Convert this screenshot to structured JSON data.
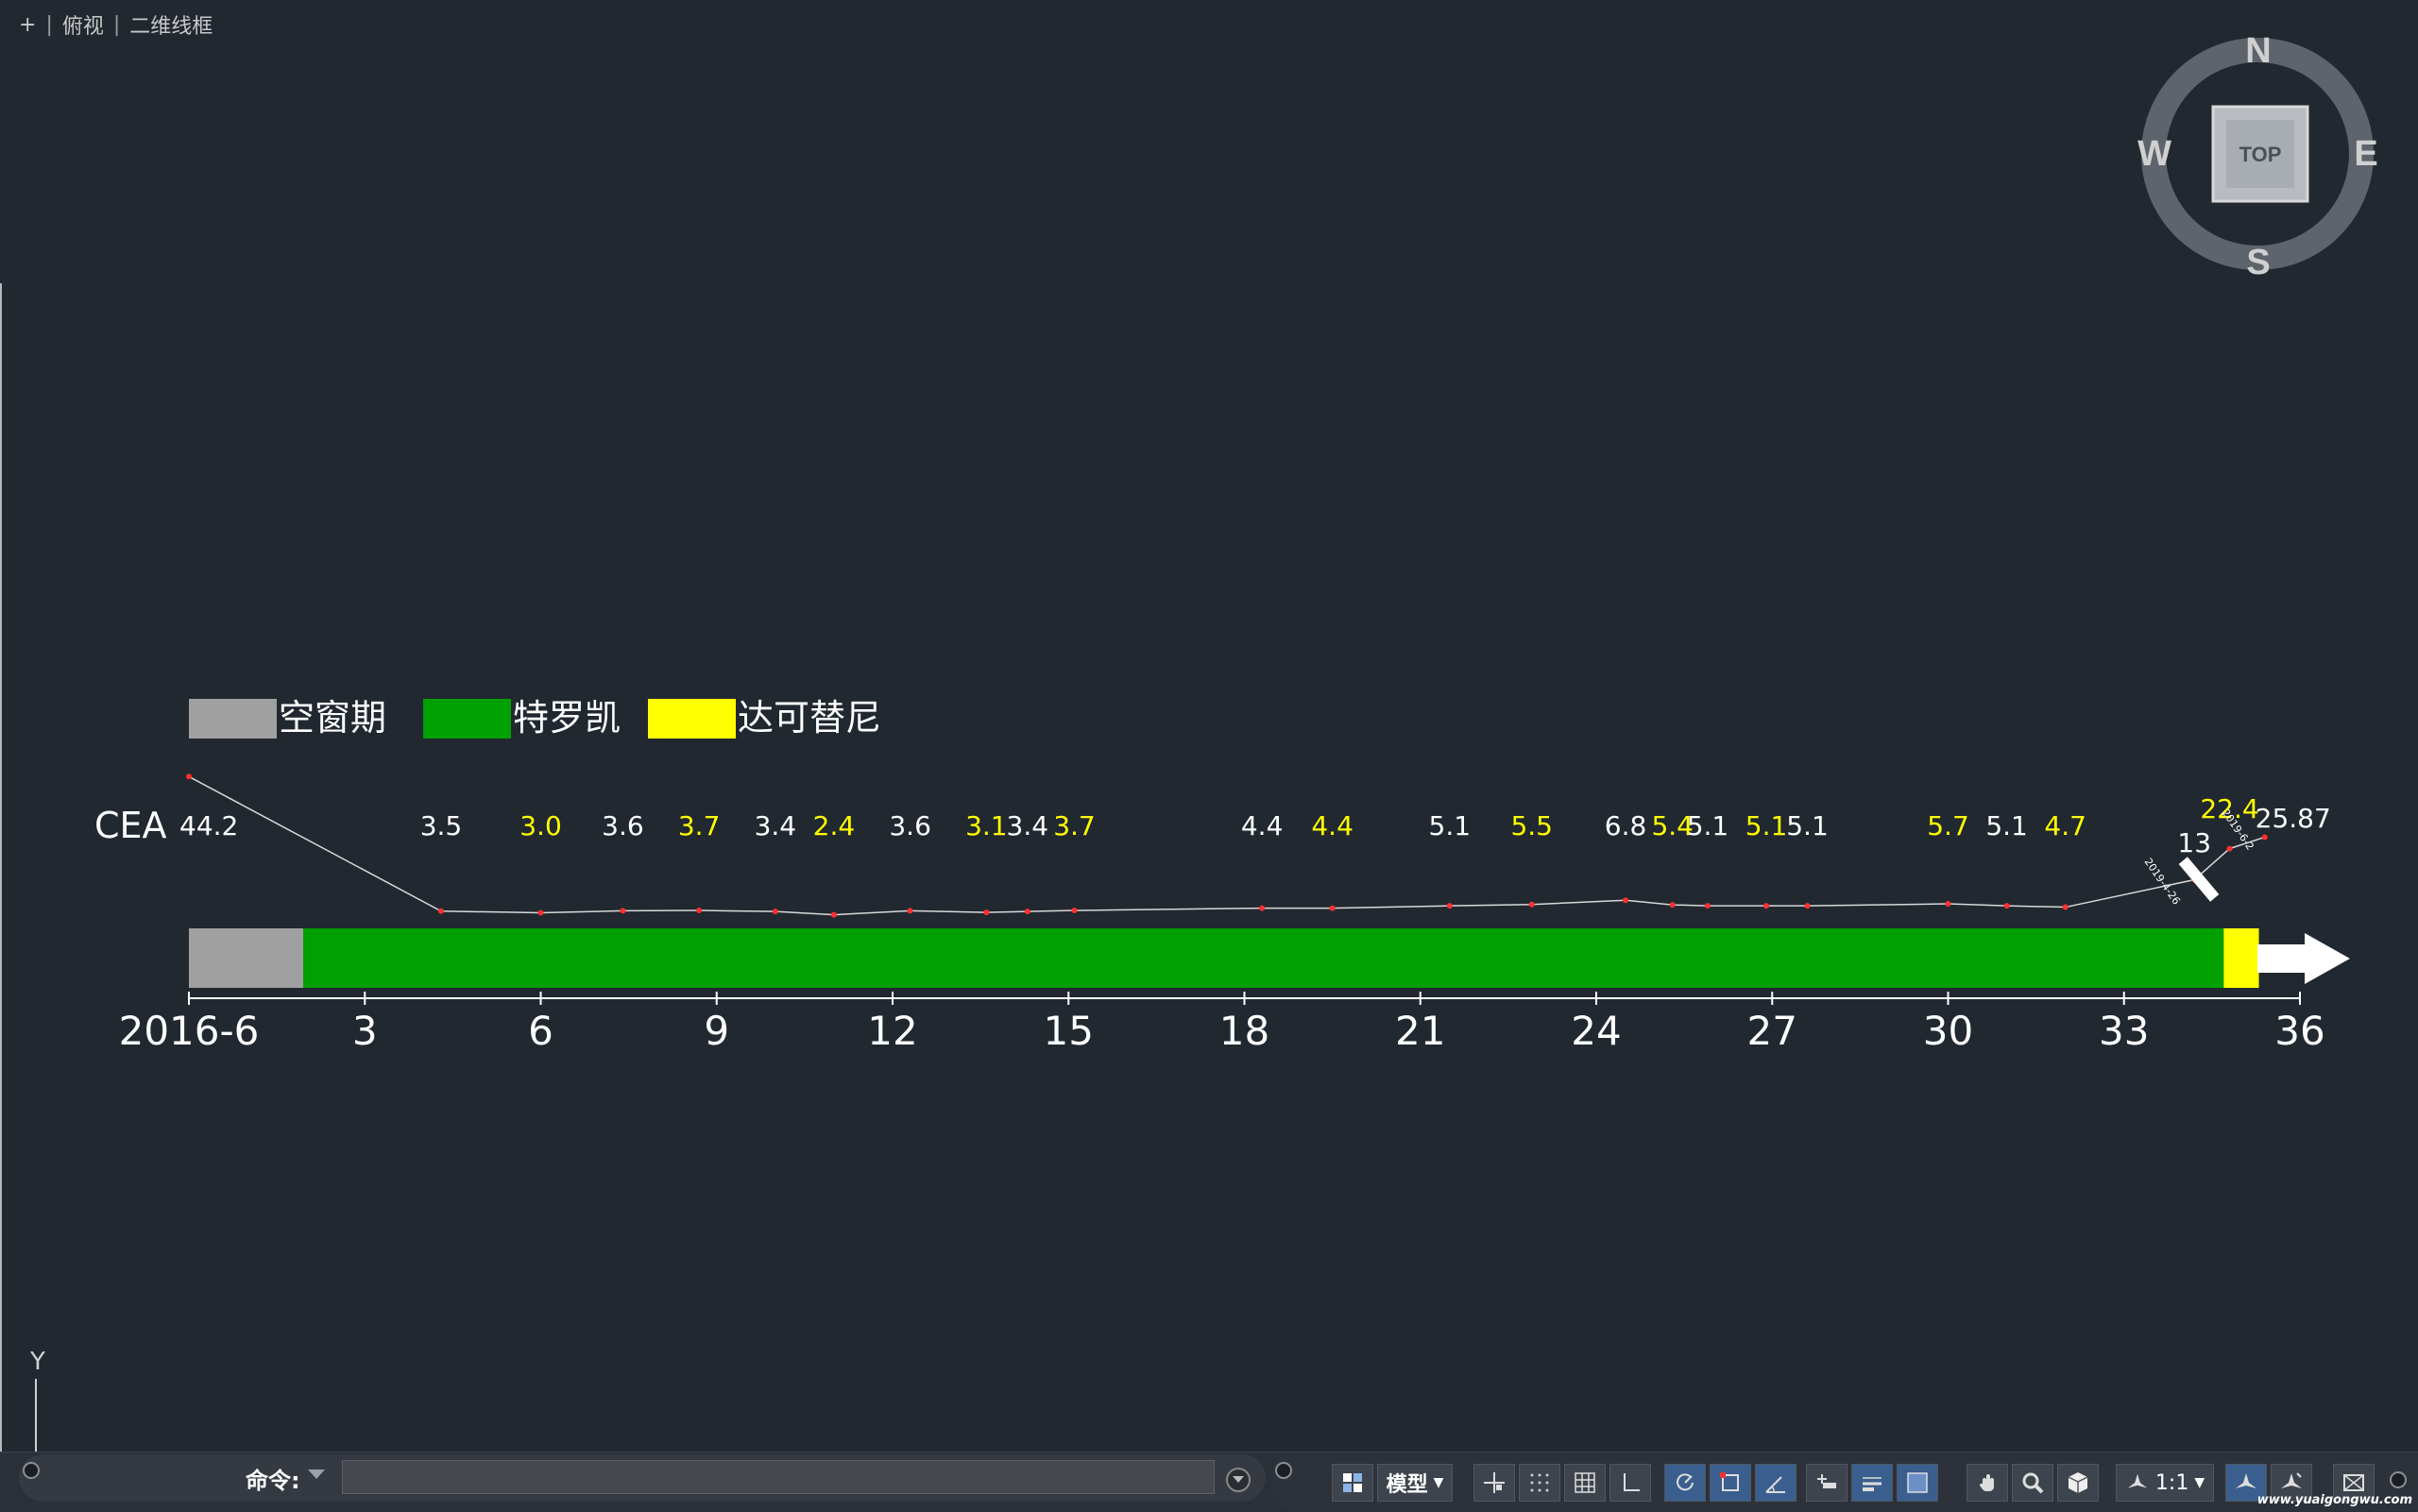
{
  "viewport": {
    "controls": "+",
    "view": "俯视",
    "style": "二维线框"
  },
  "viewcube": {
    "north": "N",
    "south": "S",
    "east": "E",
    "west": "W",
    "top": "TOP"
  },
  "ucs": {
    "y_label": "Y"
  },
  "legend": [
    {
      "label": "空窗期",
      "color": "#a0a0a0"
    },
    {
      "label": "特罗凯",
      "color": "#00a000"
    },
    {
      "label": "达可替尼",
      "color": "#ffff00"
    }
  ],
  "chart_data": {
    "type": "line",
    "series_label": "CEA",
    "axis_labels": [
      "2016-6",
      "3",
      "6",
      "9",
      "12",
      "15",
      "18",
      "21",
      "24",
      "27",
      "30",
      "33",
      "36"
    ],
    "axis_values": [
      0,
      3,
      6,
      9,
      12,
      15,
      18,
      21,
      24,
      27,
      30,
      33,
      36
    ],
    "xlim": [
      0,
      36
    ],
    "points": [
      {
        "x": 0,
        "y": 44.2,
        "label": "44.2",
        "color": "#ffffff"
      },
      {
        "x": 4.3,
        "y": 3.5,
        "label": "3.5",
        "color": "#ffffff"
      },
      {
        "x": 6.0,
        "y": 3.0,
        "label": "3.0",
        "color": "#ffff00"
      },
      {
        "x": 7.4,
        "y": 3.6,
        "label": "3.6",
        "color": "#ffffff"
      },
      {
        "x": 8.7,
        "y": 3.7,
        "label": "3.7",
        "color": "#ffff00"
      },
      {
        "x": 10.0,
        "y": 3.4,
        "label": "3.4",
        "color": "#ffffff"
      },
      {
        "x": 11.0,
        "y": 2.4,
        "label": "2.4",
        "color": "#ffff00"
      },
      {
        "x": 12.3,
        "y": 3.6,
        "label": "3.6",
        "color": "#ffffff"
      },
      {
        "x": 13.6,
        "y": 3.1,
        "label": "3.1",
        "color": "#ffff00"
      },
      {
        "x": 14.3,
        "y": 3.4,
        "label": "3.4",
        "color": "#ffffff"
      },
      {
        "x": 15.1,
        "y": 3.7,
        "label": "3.7",
        "color": "#ffff00"
      },
      {
        "x": 18.3,
        "y": 4.4,
        "label": "4.4",
        "color": "#ffffff"
      },
      {
        "x": 19.5,
        "y": 4.4,
        "label": "4.4",
        "color": "#ffff00"
      },
      {
        "x": 21.5,
        "y": 5.1,
        "label": "5.1",
        "color": "#ffffff"
      },
      {
        "x": 22.9,
        "y": 5.5,
        "label": "5.5",
        "color": "#ffff00"
      },
      {
        "x": 24.5,
        "y": 6.8,
        "label": "6.8",
        "color": "#ffffff"
      },
      {
        "x": 25.3,
        "y": 5.4,
        "label": "5.4",
        "color": "#ffff00"
      },
      {
        "x": 25.9,
        "y": 5.1,
        "label": "5.1",
        "color": "#ffffff"
      },
      {
        "x": 26.9,
        "y": 5.1,
        "label": "5.1",
        "color": "#ffff00"
      },
      {
        "x": 27.6,
        "y": 5.1,
        "label": "5.1",
        "color": "#ffffff"
      },
      {
        "x": 30.0,
        "y": 5.7,
        "label": "5.7",
        "color": "#ffff00"
      },
      {
        "x": 31.0,
        "y": 5.1,
        "label": "5.1",
        "color": "#ffffff"
      },
      {
        "x": 32.0,
        "y": 4.7,
        "label": "4.7",
        "color": "#ffff00"
      },
      {
        "x": 34.2,
        "y": 13,
        "label": "13",
        "color": "#ffffff"
      },
      {
        "x": 34.8,
        "y": 22.4,
        "label": "22.4",
        "color": "#ffff00"
      },
      {
        "x": 35.4,
        "y": 25.87,
        "label": "25.87",
        "color": "#ffffff"
      }
    ],
    "date_labels": [
      "2019-4-26",
      "2019-6-2"
    ],
    "treatment_bars": [
      {
        "name": "空窗期",
        "start": 0,
        "end": 1.95,
        "color": "#a0a0a0"
      },
      {
        "name": "特罗凯",
        "start": 1.95,
        "end": 34.7,
        "color": "#00a000"
      },
      {
        "name": "达可替尼",
        "start": 34.7,
        "end": 35.3,
        "color": "#ffff00"
      }
    ]
  },
  "command": {
    "label": "命令:",
    "value": ""
  },
  "statusbar": {
    "model_label": "模型",
    "scale_label": "1:1",
    "watermark": "www.yuaigongwu.com"
  }
}
